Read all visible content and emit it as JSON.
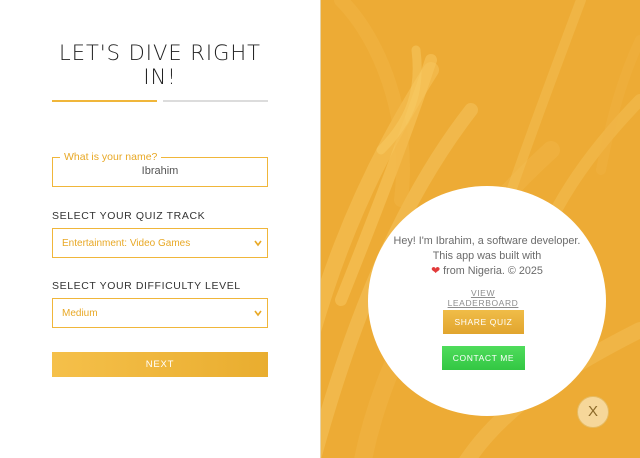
{
  "form": {
    "heading": "LET'S DIVE RIGHT IN!",
    "progress": {
      "current_step": 1,
      "total_steps": 2
    },
    "name_field": {
      "label": "What is your name?",
      "value": "Ibrahim"
    },
    "track_label": "SELECT YOUR QUIZ TRACK",
    "track_value": "Entertainment: Video Games",
    "difficulty_label": "SELECT YOUR DIFFICULTY LEVEL",
    "difficulty_value": "Medium",
    "next_label": "NEXT"
  },
  "about": {
    "line1": "Hey! I'm Ibrahim, a software developer. This app was built with",
    "heart_icon": "heart-icon",
    "line2": "from Nigeria. © 2025",
    "leaderboard_label": "VIEW LEADERBOARD",
    "share_label": "SHARE QUIZ",
    "contact_label": "CONTACT ME",
    "close_label": "X"
  },
  "colors": {
    "accent": "#f0b63a",
    "panel_bg": "#edab35",
    "contact_green": "#3fd34f"
  }
}
